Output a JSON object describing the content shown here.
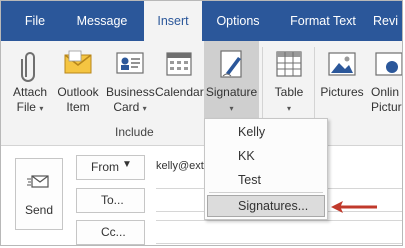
{
  "tabs": [
    {
      "label": "File"
    },
    {
      "label": "Message"
    },
    {
      "label": "Insert"
    },
    {
      "label": "Options"
    },
    {
      "label": "Format Text"
    },
    {
      "label": "Revi"
    }
  ],
  "ribbon": {
    "buttons": [
      {
        "line1": "Attach",
        "line2": "File"
      },
      {
        "line1": "Outlook",
        "line2": "Item"
      },
      {
        "line1": "Business",
        "line2": "Card"
      },
      {
        "line1": "Calendar",
        "line2": ""
      },
      {
        "line1": "Signature",
        "line2": ""
      },
      {
        "line1": "Table",
        "line2": ""
      },
      {
        "line1": "Pictures",
        "line2": ""
      },
      {
        "line1": "Onlin",
        "line2": "Pictur"
      }
    ],
    "group_label": "Include"
  },
  "signature_menu": {
    "items": [
      "Kelly",
      "KK",
      "Test"
    ],
    "signatures_label": "Signatures..."
  },
  "compose": {
    "send_label": "Send",
    "from_label": "From",
    "from_value": "kelly@ext",
    "to_label": "To...",
    "cc_label": "Cc..."
  },
  "colors": {
    "tabbar": "#2b579a",
    "ribbon": "#f3f3f3",
    "arrow": "#c0392b"
  }
}
